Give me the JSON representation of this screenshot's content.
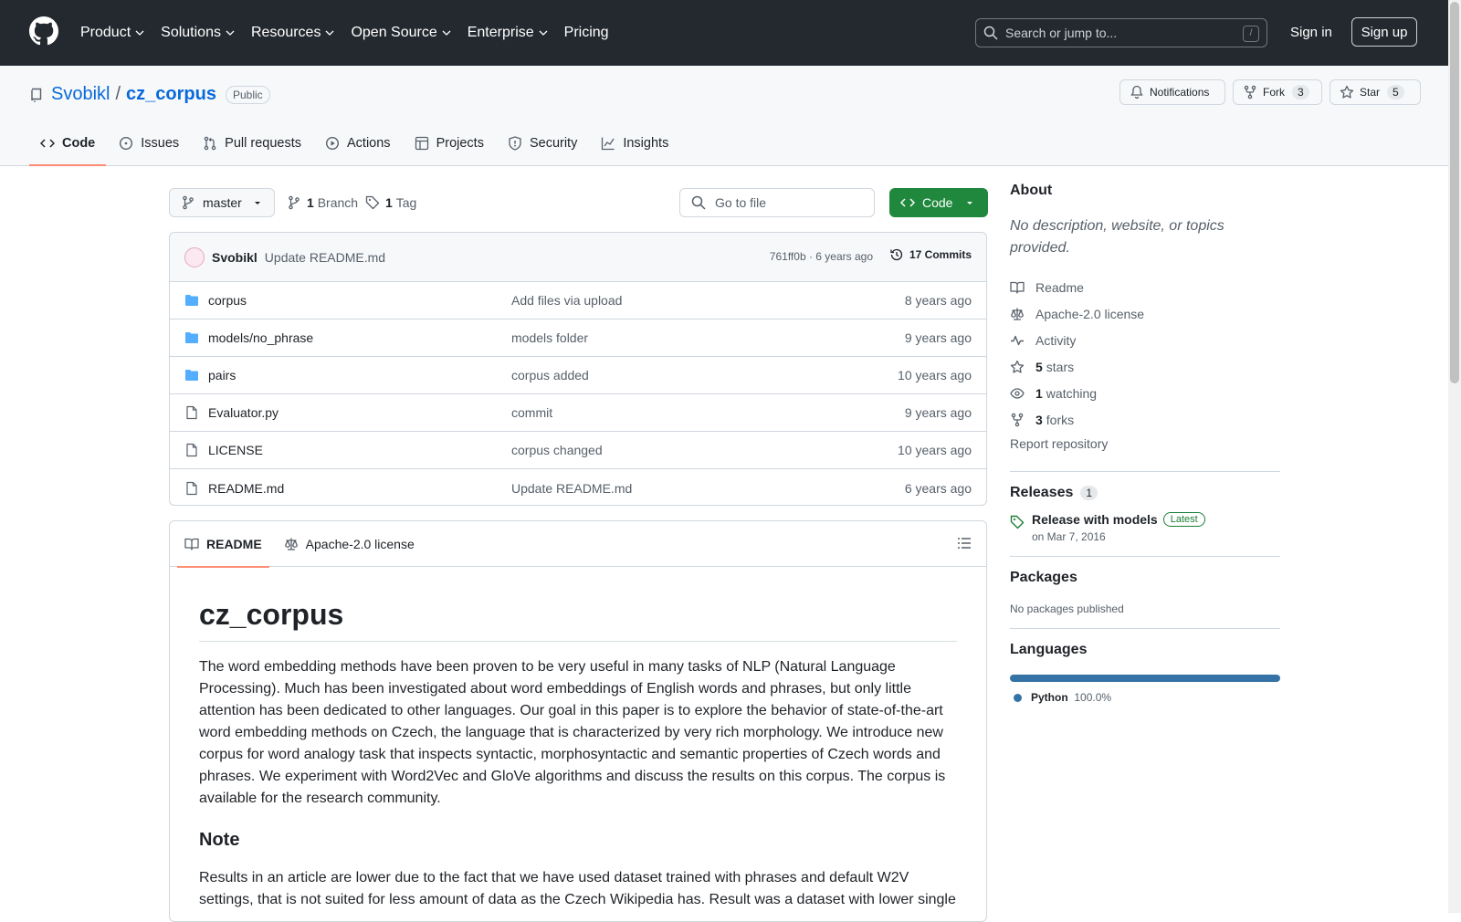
{
  "nav": {
    "items": [
      "Product",
      "Solutions",
      "Resources",
      "Open Source",
      "Enterprise",
      "Pricing"
    ],
    "search_placeholder": "Search or jump to...",
    "search_shortcut": "/",
    "signin": "Sign in",
    "signup": "Sign up"
  },
  "repo": {
    "owner": "Svobikl",
    "separator": "/",
    "name": "cz_corpus",
    "visibility": "Public",
    "notifications": "Notifications",
    "fork_label": "Fork",
    "fork_count": "3",
    "star_label": "Star",
    "star_count": "5"
  },
  "tabs": [
    "Code",
    "Issues",
    "Pull requests",
    "Actions",
    "Projects",
    "Security",
    "Insights"
  ],
  "toolbar": {
    "branch": "master",
    "branch_count": "1",
    "branch_label": "Branch",
    "tag_count": "1",
    "tag_label": "Tag",
    "gofile": "Go to file",
    "code": "Code"
  },
  "commit": {
    "author": "Svobikl",
    "message": "Update README.md",
    "meta": "761ff0b · 6 years ago",
    "commits": "17 Commits"
  },
  "files": [
    {
      "name": "corpus",
      "type": "folder",
      "message": "Add files via upload",
      "date": "8 years ago"
    },
    {
      "name": "models/no_phrase",
      "type": "folder",
      "message": "models folder",
      "date": "9 years ago"
    },
    {
      "name": "pairs",
      "type": "folder",
      "message": "corpus added",
      "date": "10 years ago"
    },
    {
      "name": "Evaluator.py",
      "type": "file",
      "message": "commit",
      "date": "9 years ago"
    },
    {
      "name": "LICENSE",
      "type": "file",
      "message": "corpus changed",
      "date": "10 years ago"
    },
    {
      "name": "README.md",
      "type": "file",
      "message": "Update README.md",
      "date": "6 years ago"
    }
  ],
  "readme": {
    "tab_readme": "README",
    "tab_license": "Apache-2.0 license",
    "title": "cz_corpus",
    "paragraph": "The word embedding methods have been proven to be very useful in many tasks of NLP (Natural Language Processing). Much has been investigated about word embeddings of English words and phrases, but only little attention has been dedicated to other languages. Our goal in this paper is to explore the behavior of state-of-the-art word embedding methods on Czech, the language that is characterized by very rich morphology. We introduce new corpus for word analogy task that inspects syntactic, morphosyntactic and semantic properties of Czech words and phrases. We experiment with Word2Vec and GloVe algorithms and discuss the results on this corpus. The corpus is available for the research community.",
    "note_heading": "Note",
    "note": "Results in an article are lower due to the fact that we have used dataset trained with phrases and default W2V settings, that is not suited for less amount of data as the Czech Wikipedia has. Result was a dataset with lower single"
  },
  "about": {
    "heading": "About",
    "description": "No description, website, or topics provided.",
    "readme": "Readme",
    "license": "Apache-2.0 license",
    "activity": "Activity",
    "stars_count": "5",
    "stars_label": "stars",
    "watching_count": "1",
    "watching_label": "watching",
    "forks_count": "3",
    "forks_label": "forks",
    "report": "Report repository"
  },
  "releases": {
    "heading": "Releases",
    "count": "1",
    "title": "Release with models",
    "badge": "Latest",
    "date": "on Mar 7, 2016"
  },
  "packages": {
    "heading": "Packages",
    "text": "No packages published"
  },
  "languages": {
    "heading": "Languages",
    "items": [
      {
        "name": "Python",
        "percent": "100.0%",
        "color": "#3572A5",
        "fraction": 1.0
      }
    ]
  },
  "colors": {
    "header_bg": "#24292f",
    "accent": "#0969da",
    "code_button": "#1f883d",
    "tab_underline": "#fd8c73"
  }
}
